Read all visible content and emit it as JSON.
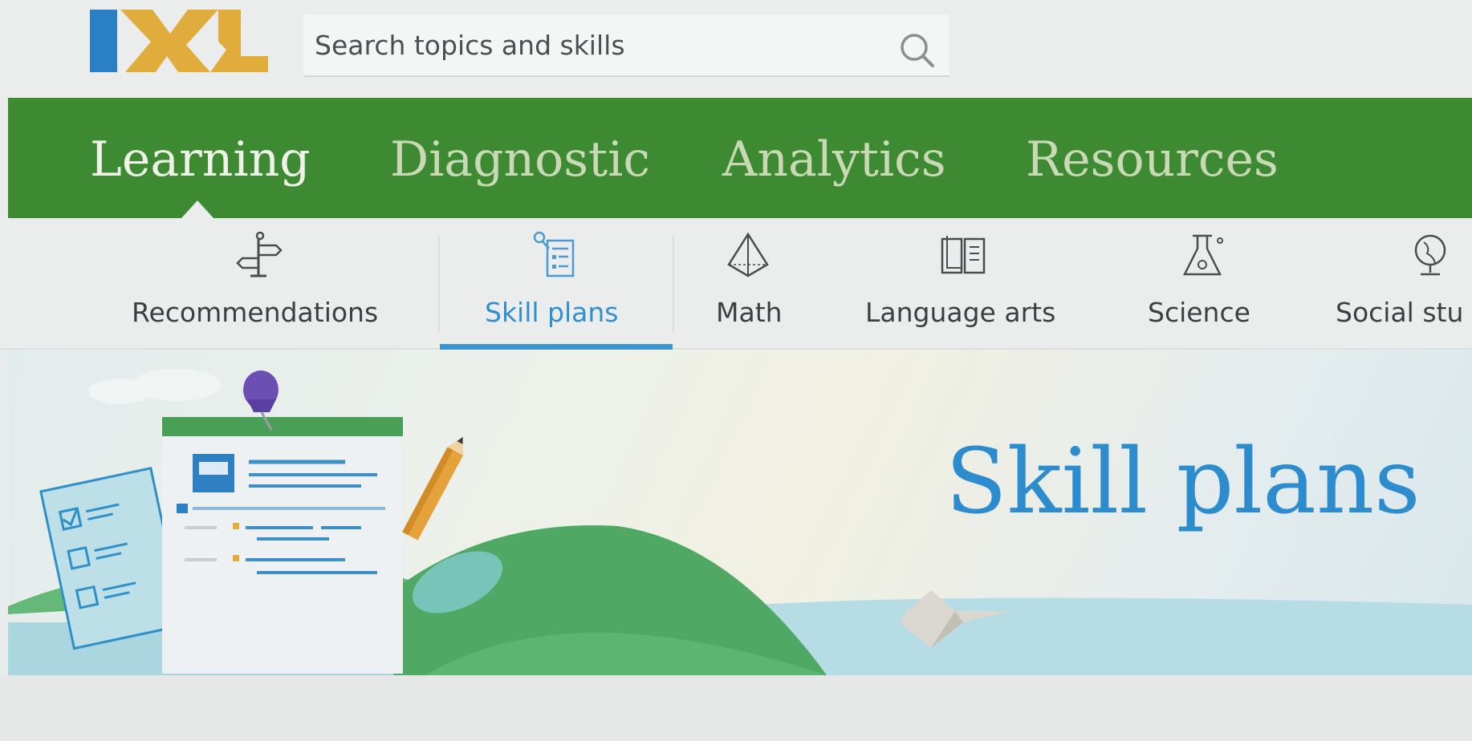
{
  "brand": {
    "logo_text": "IXL",
    "colors": {
      "blue": "#2b7fc3",
      "gold": "#e0ad3c",
      "green": "#3d8a33",
      "accent": "#2d8ccd"
    }
  },
  "search": {
    "placeholder": "Search topics and skills",
    "icon": "search-icon"
  },
  "main_nav": {
    "tabs": [
      {
        "label": "Learning",
        "active": true
      },
      {
        "label": "Diagnostic",
        "active": false
      },
      {
        "label": "Analytics",
        "active": false
      },
      {
        "label": "Resources",
        "active": false
      }
    ]
  },
  "sub_nav": {
    "items": [
      {
        "label": "Recommendations",
        "icon": "signpost-icon",
        "active": false
      },
      {
        "label": "Skill plans",
        "icon": "skill-plan-icon",
        "active": true
      },
      {
        "label": "Math",
        "icon": "pyramid-icon",
        "active": false
      },
      {
        "label": "Language arts",
        "icon": "book-icon",
        "active": false
      },
      {
        "label": "Science",
        "icon": "flask-icon",
        "active": false
      },
      {
        "label": "Social stu",
        "icon": "globe-icon",
        "active": false
      }
    ]
  },
  "hero": {
    "title": "Skill plans"
  }
}
